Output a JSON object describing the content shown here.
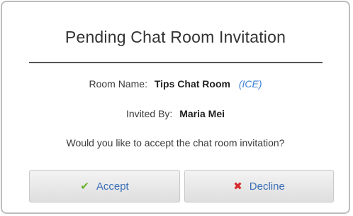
{
  "dialog": {
    "title": "Pending Chat Room Invitation",
    "room_label": "Room Name:",
    "room_name": "Tips Chat Room",
    "room_tag": "(ICE)",
    "invited_label": "Invited By:",
    "invited_by": "Maria Mei",
    "question": "Would you like to accept the chat room invitation?"
  },
  "buttons": {
    "accept_label": "Accept",
    "decline_label": "Decline",
    "accept_icon": "checkmark-icon",
    "decline_icon": "x-icon"
  },
  "colors": {
    "link": "#3b7fd6",
    "check": "#6bb12e",
    "cross": "#d62b2b"
  }
}
